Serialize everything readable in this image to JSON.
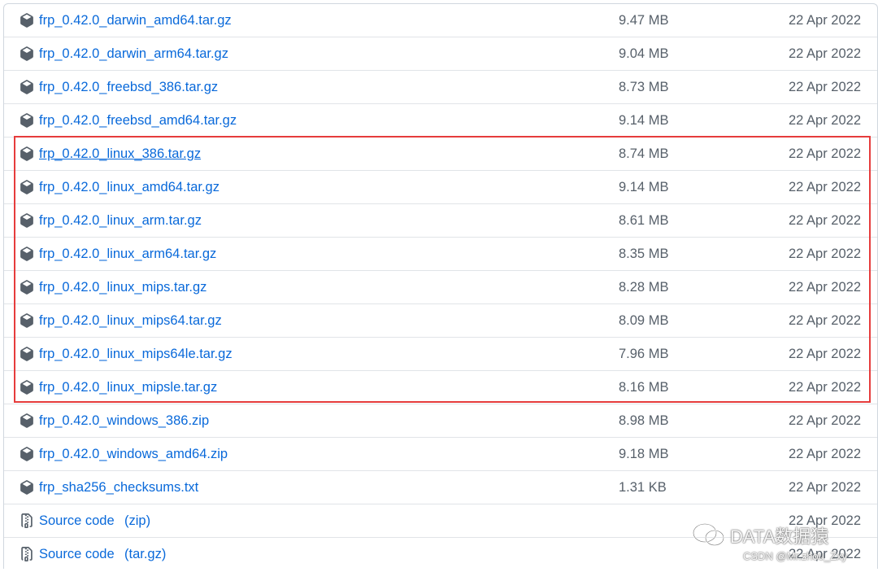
{
  "assets": [
    {
      "name": "frp_0.42.0_darwin_amd64.tar.gz",
      "size": "9.47 MB",
      "date": "22 Apr 2022",
      "icon": "package-icon"
    },
    {
      "name": "frp_0.42.0_darwin_arm64.tar.gz",
      "size": "9.04 MB",
      "date": "22 Apr 2022",
      "icon": "package-icon"
    },
    {
      "name": "frp_0.42.0_freebsd_386.tar.gz",
      "size": "8.73 MB",
      "date": "22 Apr 2022",
      "icon": "package-icon"
    },
    {
      "name": "frp_0.42.0_freebsd_amd64.tar.gz",
      "size": "9.14 MB",
      "date": "22 Apr 2022",
      "icon": "package-icon"
    },
    {
      "name": "frp_0.42.0_linux_386.tar.gz",
      "size": "8.74 MB",
      "date": "22 Apr 2022",
      "icon": "package-icon"
    },
    {
      "name": "frp_0.42.0_linux_amd64.tar.gz",
      "size": "9.14 MB",
      "date": "22 Apr 2022",
      "icon": "package-icon"
    },
    {
      "name": "frp_0.42.0_linux_arm.tar.gz",
      "size": "8.61 MB",
      "date": "22 Apr 2022",
      "icon": "package-icon"
    },
    {
      "name": "frp_0.42.0_linux_arm64.tar.gz",
      "size": "8.35 MB",
      "date": "22 Apr 2022",
      "icon": "package-icon"
    },
    {
      "name": "frp_0.42.0_linux_mips.tar.gz",
      "size": "8.28 MB",
      "date": "22 Apr 2022",
      "icon": "package-icon"
    },
    {
      "name": "frp_0.42.0_linux_mips64.tar.gz",
      "size": "8.09 MB",
      "date": "22 Apr 2022",
      "icon": "package-icon"
    },
    {
      "name": "frp_0.42.0_linux_mips64le.tar.gz",
      "size": "7.96 MB",
      "date": "22 Apr 2022",
      "icon": "package-icon"
    },
    {
      "name": "frp_0.42.0_linux_mipsle.tar.gz",
      "size": "8.16 MB",
      "date": "22 Apr 2022",
      "icon": "package-icon"
    },
    {
      "name": "frp_0.42.0_windows_386.zip",
      "size": "8.98 MB",
      "date": "22 Apr 2022",
      "icon": "package-icon"
    },
    {
      "name": "frp_0.42.0_windows_amd64.zip",
      "size": "9.18 MB",
      "date": "22 Apr 2022",
      "icon": "package-icon"
    },
    {
      "name": "frp_sha256_checksums.txt",
      "size": "1.31 KB",
      "date": "22 Apr 2022",
      "icon": "package-icon"
    }
  ],
  "source_code": [
    {
      "label": "Source code",
      "format": "(zip)",
      "date": "22 Apr 2022",
      "icon": "file-zip-icon"
    },
    {
      "label": "Source code",
      "format": "(tar.gz)",
      "date": "22 Apr 2022",
      "icon": "file-zip-icon"
    }
  ],
  "watermark": {
    "brand": "DATA数据猿",
    "credit": "CSDN @Mr.zhou_Zxy"
  },
  "colors": {
    "link": "#0969da",
    "muted": "#57606a",
    "border": "#d0d7de",
    "highlight": "#e63c3c"
  }
}
